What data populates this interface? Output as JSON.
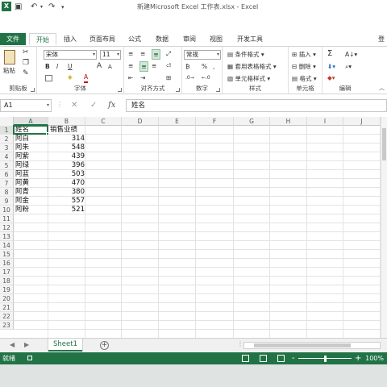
{
  "titlebar": {
    "app_icon": "X",
    "save_icon": "save-icon",
    "undo_icon": "undo-icon",
    "redo_icon": "redo-icon",
    "title": "新建Microsoft Excel 工作表.xlsx - Excel"
  },
  "ribbon_tabs": {
    "file": "文件",
    "items": [
      "开始",
      "插入",
      "页面布局",
      "公式",
      "数据",
      "审阅",
      "视图",
      "开发工具"
    ],
    "active": "开始",
    "signin": "登"
  },
  "ribbon": {
    "clipboard": {
      "label": "剪贴板",
      "paste": "粘贴"
    },
    "font": {
      "label": "字体",
      "font_name": "宋体",
      "font_size": "11",
      "bold": "B",
      "italic": "I",
      "underline": "U",
      "grow": "A",
      "shrink": "A"
    },
    "alignment": {
      "label": "对齐方式"
    },
    "number": {
      "label": "数字",
      "format": "常规",
      "percent": "%",
      "comma": ","
    },
    "styles": {
      "label": "样式",
      "conditional": "条件格式",
      "table": "套用表格格式",
      "cell_styles": "单元格样式"
    },
    "cells": {
      "label": "单元格",
      "insert": "插入",
      "delete": "删除",
      "format": "格式"
    },
    "editing": {
      "label": "编辑",
      "sum": "Σ"
    }
  },
  "formula_bar": {
    "name_box": "A1",
    "fx": "fx",
    "content": "姓名"
  },
  "grid": {
    "columns": [
      "A",
      "B",
      "C",
      "D",
      "E",
      "F",
      "G",
      "H",
      "I",
      "J"
    ],
    "rows": [
      "1",
      "2",
      "3",
      "4",
      "5",
      "6",
      "7",
      "8",
      "9",
      "10",
      "11",
      "12",
      "13",
      "14",
      "15",
      "16",
      "17",
      "18",
      "19",
      "20",
      "21",
      "22",
      "23"
    ],
    "header": {
      "name": "姓名",
      "sales": "销售业绩"
    },
    "records": [
      {
        "name": "阿白",
        "sales": "314"
      },
      {
        "name": "阿朱",
        "sales": "548"
      },
      {
        "name": "阿紫",
        "sales": "439"
      },
      {
        "name": "阿绿",
        "sales": "396"
      },
      {
        "name": "阿蓝",
        "sales": "503"
      },
      {
        "name": "阿黄",
        "sales": "470"
      },
      {
        "name": "阿青",
        "sales": "380"
      },
      {
        "name": "阿金",
        "sales": "557"
      },
      {
        "name": "阿粉",
        "sales": "521"
      }
    ]
  },
  "sheets": {
    "active": "Sheet1",
    "add": "+"
  },
  "statusbar": {
    "status": "就绪",
    "zoom_minus": "-",
    "zoom_plus": "+",
    "zoom": "100%"
  },
  "colors": {
    "accent": "#217346",
    "header_bg": "#f3f3f3"
  }
}
